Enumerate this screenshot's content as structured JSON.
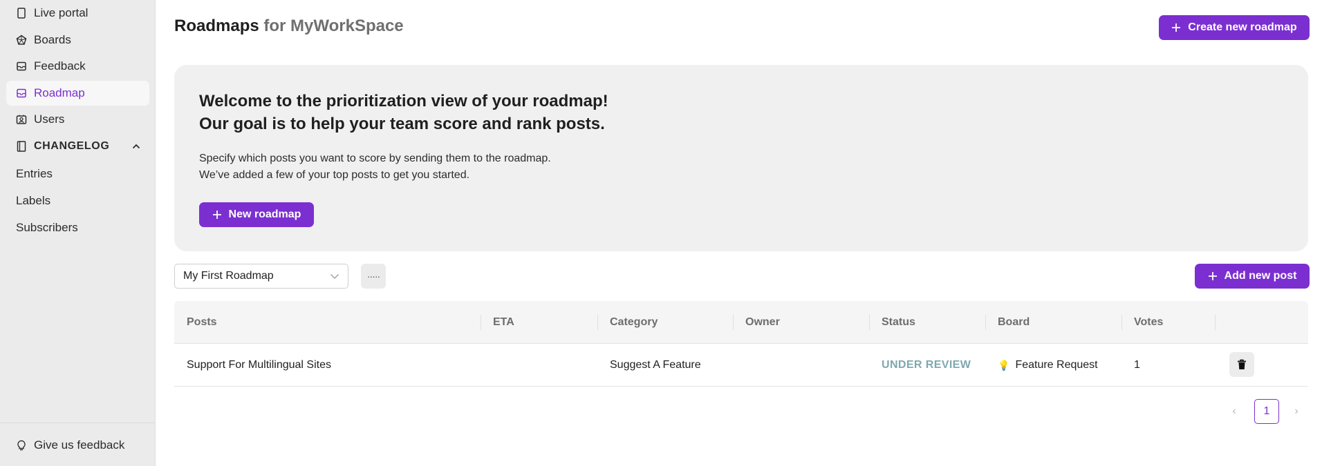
{
  "sidebar": {
    "items": [
      {
        "label": "Live portal",
        "icon": "phone-icon"
      },
      {
        "label": "Boards",
        "icon": "boards-icon"
      },
      {
        "label": "Feedback",
        "icon": "inbox-icon"
      },
      {
        "label": "Roadmap",
        "icon": "inbox-icon",
        "active": true
      },
      {
        "label": "Users",
        "icon": "users-icon"
      }
    ],
    "changelog": {
      "label": "CHANGELOG",
      "items": [
        "Entries",
        "Labels",
        "Subscribers"
      ]
    },
    "footer_label": "Give us feedback"
  },
  "header": {
    "title": "Roadmaps",
    "workspace": "for MyWorkSpace",
    "create_label": "Create new roadmap"
  },
  "welcome": {
    "heading_line1": "Welcome to the prioritization view of your roadmap!",
    "heading_line2": "Our goal is to help your team score and rank posts.",
    "body_line1": "Specify which posts you want to score by sending them to the roadmap.",
    "body_line2": "We’ve added a few of your top posts to get you started.",
    "new_roadmap_label": "New roadmap"
  },
  "toolbar": {
    "selected_roadmap": "My First Roadmap",
    "more_label": "·····",
    "add_post_label": "Add new post"
  },
  "table": {
    "columns": [
      "Posts",
      "ETA",
      "Category",
      "Owner",
      "Status",
      "Board",
      "Votes"
    ],
    "rows": [
      {
        "post": "Support For Multilingual Sites",
        "eta": "",
        "category": "Suggest A Feature",
        "owner": "",
        "status": "UNDER REVIEW",
        "board_icon": "💡",
        "board": "Feature Request",
        "votes": "1"
      }
    ]
  },
  "pagination": {
    "current_page": "1",
    "prev": "‹",
    "next": "›"
  },
  "colors": {
    "accent": "#7b2fd0",
    "status_under_review": "#7fa7b0"
  }
}
